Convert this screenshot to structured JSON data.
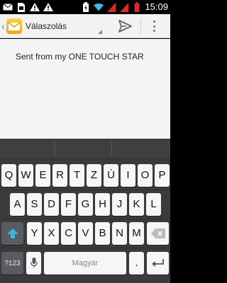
{
  "status_bar": {
    "time": "15:09",
    "icons": [
      "email-icon",
      "sim-icon",
      "warning-icon",
      "warning-icon",
      "battery-charging-icon",
      "wifi-icon",
      "signal-icon",
      "signal-icon",
      "battery-icon"
    ]
  },
  "action_bar": {
    "title": "Válaszolás",
    "app_icon": "email-app-icon",
    "send_icon": "send-icon",
    "overflow_icon": "overflow-menu-icon"
  },
  "compose": {
    "body": "Sent from my ONE TOUCH STAR"
  },
  "keyboard": {
    "row1": [
      "Q",
      "W",
      "E",
      "R",
      "T",
      "Z",
      "Ú",
      "I",
      "O",
      "P"
    ],
    "row2": [
      "A",
      "S",
      "D",
      "F",
      "G",
      "H",
      "J",
      "K",
      "L"
    ],
    "row3": [
      "Y",
      "X",
      "C",
      "V",
      "B",
      "N",
      "M"
    ],
    "symbols_label": "?123",
    "space_label": "Magyar",
    "period_label": ".",
    "mic_icon": "microphone-icon",
    "shift_icon": "shift-icon",
    "delete_icon": "backspace-icon",
    "enter_icon": "enter-icon"
  }
}
